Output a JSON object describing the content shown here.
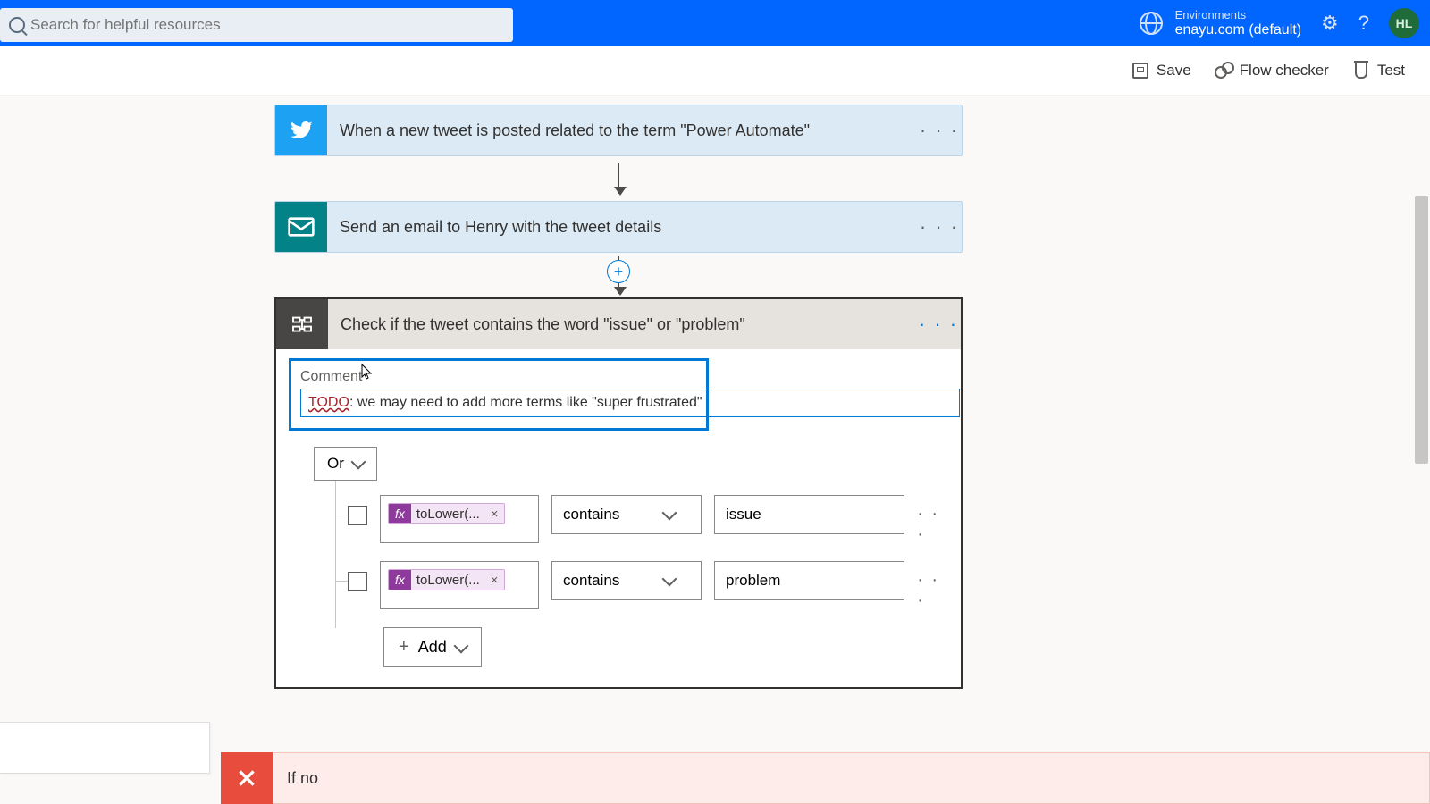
{
  "search": {
    "placeholder": "Search for helpful resources"
  },
  "env": {
    "label": "Environments",
    "name": "enayu.com (default)"
  },
  "avatar": "HL",
  "actions": {
    "save": "Save",
    "checker": "Flow checker",
    "test": "Test"
  },
  "steps": {
    "trigger": "When a new tweet is posted related to the term \"Power Automate\"",
    "email": "Send an email to Henry with the tweet details",
    "condition": "Check if the tweet contains the word \"issue\" or \"problem\""
  },
  "comment": {
    "label": "Comment",
    "value_prefix": "TODO",
    "value_suffix": ": we may need to add more terms like \"super frustrated\""
  },
  "logic": {
    "group": "Or",
    "add": "Add",
    "rows": [
      {
        "expr": "toLower(...",
        "op": "contains",
        "val": "issue"
      },
      {
        "expr": "toLower(...",
        "op": "contains",
        "val": "problem"
      }
    ]
  },
  "ifno": "If no",
  "dots": "· · ·",
  "fx": "fx"
}
